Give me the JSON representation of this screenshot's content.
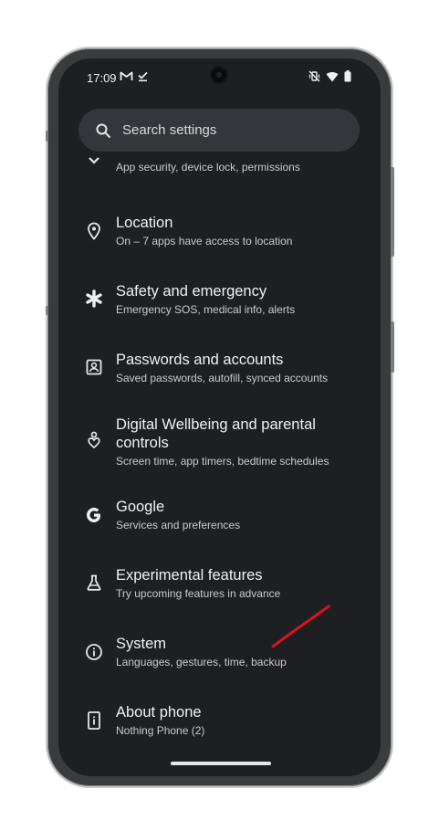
{
  "status_bar": {
    "time": "17:09",
    "left_icons": [
      "gmail-icon",
      "check-icon"
    ],
    "right_icons": [
      "vibrate-off-icon",
      "wifi-icon",
      "battery-icon"
    ]
  },
  "search": {
    "placeholder": "Search settings"
  },
  "settings": {
    "items": [
      {
        "icon": "shield-expand-icon",
        "title": "",
        "subtitle": "App security, device lock, permissions"
      },
      {
        "icon": "location-pin-icon",
        "title": "Location",
        "subtitle": "On – 7 apps have access to location"
      },
      {
        "icon": "asterisk-icon",
        "title": "Safety and emergency",
        "subtitle": "Emergency SOS, medical info, alerts"
      },
      {
        "icon": "account-box-icon",
        "title": "Passwords and accounts",
        "subtitle": "Saved passwords, autofill, synced accounts"
      },
      {
        "icon": "wellbeing-icon",
        "title": "Digital Wellbeing and parental controls",
        "subtitle": "Screen time, app timers, bedtime schedules"
      },
      {
        "icon": "google-icon",
        "title": "Google",
        "subtitle": "Services and preferences"
      },
      {
        "icon": "flask-icon",
        "title": "Experimental features",
        "subtitle": "Try upcoming features in advance"
      },
      {
        "icon": "info-icon",
        "title": "System",
        "subtitle": "Languages, gestures, time, backup"
      },
      {
        "icon": "phone-info-icon",
        "title": "About phone",
        "subtitle": "Nothing Phone (2)"
      }
    ]
  },
  "colors": {
    "screen_bg": "#1d1f22",
    "search_bg": "#33363a",
    "annotation": "#d9141f"
  }
}
